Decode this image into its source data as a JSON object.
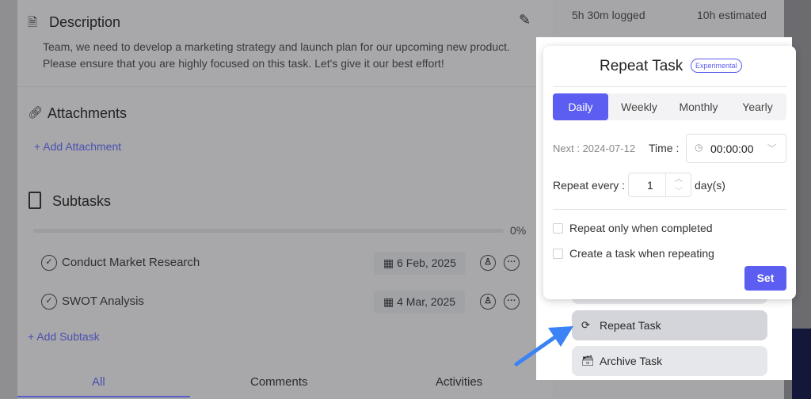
{
  "time": {
    "logged": "5h 30m logged",
    "estimated": "10h estimated"
  },
  "description": {
    "title": "Description",
    "text": "Team, we need to develop a marketing strategy and launch plan for our upcoming new product. Please ensure that you are highly focused on this task. Let's give it our best effort!"
  },
  "attachments": {
    "title": "Attachments",
    "add": "Add Attachment"
  },
  "subtasks": {
    "title": "Subtasks",
    "progress": "0%",
    "progress_value": 0,
    "items": [
      {
        "name": "Conduct Market Research",
        "date": "6 Feb, 2025"
      },
      {
        "name": "SWOT Analysis",
        "date": "4 Mar, 2025"
      }
    ],
    "add": "Add Subtask"
  },
  "tabs": [
    "All",
    "Comments",
    "Activities"
  ],
  "repeat": {
    "title": "Repeat Task",
    "badge": "Experimental",
    "frequencies": [
      "Daily",
      "Weekly",
      "Monthly",
      "Yearly"
    ],
    "selected": "Daily",
    "next": "Next : 2024-07-12",
    "time_label": "Time :",
    "time_value": "00:00:00",
    "repeat_every_label": "Repeat every :",
    "repeat_every_value": "1",
    "unit": "day(s)",
    "option1": "Repeat only when completed",
    "option2": "Create a task when repeating",
    "set": "Set",
    "accent": "#5b5ef0"
  },
  "menu": {
    "repeat": "Repeat Task",
    "archive": "Archive Task"
  },
  "arrow_color": "#3b82f6"
}
